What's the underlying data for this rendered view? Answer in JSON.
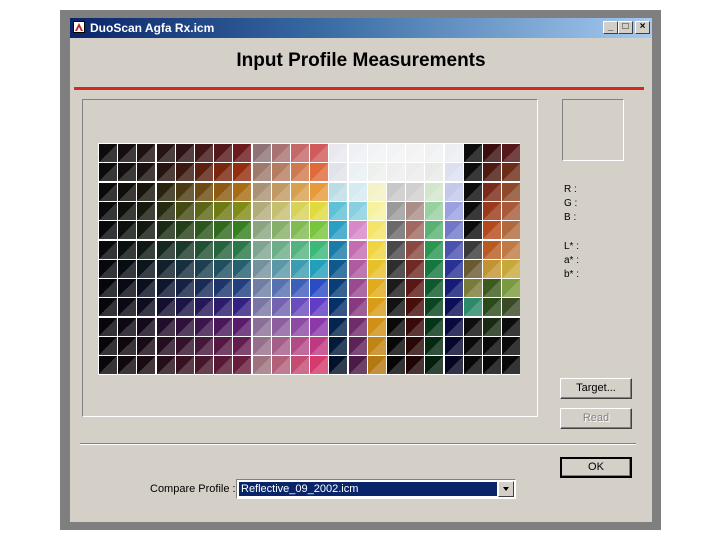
{
  "window": {
    "title": "DuoScan Agfa Rx.icm",
    "buttons": {
      "minimize": "_",
      "maximize": "□",
      "close": "×"
    }
  },
  "heading": "Input Profile Measurements",
  "readouts": {
    "r": "R :",
    "g": "G :",
    "b": "B :",
    "l": "L* :",
    "a": "a* :",
    "bstar": "b* :"
  },
  "buttons": {
    "target": "Target...",
    "read": "Read",
    "ok": "OK"
  },
  "compare": {
    "label": "Compare Profile :",
    "selected": "Reflective_09_2002.icm"
  },
  "colors": {
    "title_gradient_start": "#0a246a",
    "accent_rule": "#d42a1a",
    "dialog_bg": "#d4d0c8",
    "selection": "#0a246a"
  },
  "target_grid": {
    "columns": 22,
    "rows": 12,
    "rows_colors": [
      [
        "#0d0b0c",
        "#140e0f",
        "#1d1111",
        "#261313",
        "#2e1316",
        "#401616",
        "#55181a",
        "#6c1a1c",
        "#8e7374",
        "#aa7171",
        "#c46868",
        "#d05a5c",
        "#e8e8ee",
        "#eef0f4",
        "#f2f3f5",
        "#f2f3f4",
        "#f3f3f4",
        "#f0f1f2",
        "#eceef3",
        "#0c0c0c",
        "#3a0e0e",
        "#55181a"
      ],
      [
        "#0b0b0b",
        "#110e0d",
        "#1b1110",
        "#27130f",
        "#3a1a10",
        "#5c2010",
        "#78260e",
        "#952c0e",
        "#9e7a6d",
        "#b67c62",
        "#cf7a4e",
        "#df6b3a",
        "#e2e3ea",
        "#eaf0f4",
        "#eef0ee",
        "#eeeeee",
        "#ececec",
        "#e7eae6",
        "#dcdff0",
        "#0c0c0c",
        "#4c1a10",
        "#6b2c18"
      ],
      [
        "#0a0a0a",
        "#0f0e0b",
        "#18150d",
        "#2a220d",
        "#4a3a12",
        "#6c4a12",
        "#8c5a10",
        "#a86c12",
        "#a99275",
        "#c09a62",
        "#d7a04e",
        "#e79a3a",
        "#bcdde6",
        "#d5ebf2",
        "#f4f2c6",
        "#c8c8c8",
        "#d0d0d0",
        "#d2e6cc",
        "#c4c8ea",
        "#0c0c0c",
        "#7a2a18",
        "#8c4a2a"
      ],
      [
        "#090a09",
        "#0e100c",
        "#17190d",
        "#262a0e",
        "#444a12",
        "#5c6614",
        "#6e7a14",
        "#808c16",
        "#b1ac7a",
        "#c4c070",
        "#d8d25a",
        "#e0da3e",
        "#5fc1d6",
        "#88cfe2",
        "#f7f2a0",
        "#9a9a9a",
        "#ac8e88",
        "#98d0a0",
        "#9aa0e0",
        "#0c0c0c",
        "#9a3a1a",
        "#a85a3a"
      ],
      [
        "#08090a",
        "#0c110d",
        "#121a10",
        "#1a2a14",
        "#24401a",
        "#2c561c",
        "#306a1e",
        "#348020",
        "#8aa580",
        "#86b06a",
        "#80bc52",
        "#78c63c",
        "#2a9fc2",
        "#d688c8",
        "#f4e468",
        "#6a6a6a",
        "#a06a62",
        "#5ab272",
        "#7278c8",
        "#0c0c0c",
        "#b44a1c",
        "#b06a3e"
      ],
      [
        "#07090a",
        "#0a100f",
        "#0f1914",
        "#15281f",
        "#1c3a2a",
        "#225034",
        "#26643e",
        "#2a7848",
        "#7fa590",
        "#6cae88",
        "#54b480",
        "#3cb878",
        "#1a7aa8",
        "#c46cb0",
        "#f0d440",
        "#4a4a4a",
        "#8a4a42",
        "#2a9652",
        "#4a52b0",
        "#3a3a3a",
        "#b85a22",
        "#c07a44"
      ],
      [
        "#06080b",
        "#080d12",
        "#0c141c",
        "#10202c",
        "#16303e",
        "#1c4050",
        "#205060",
        "#246070",
        "#74929e",
        "#5a98a8",
        "#3e9cb2",
        "#22a0ba",
        "#0e5a8e",
        "#b05aa0",
        "#e8c02a",
        "#2e2e2e",
        "#702a24",
        "#16783e",
        "#2a3296",
        "#6a5a32",
        "#c09432",
        "#c8a83a"
      ],
      [
        "#06070b",
        "#080a14",
        "#0b0f20",
        "#0e1630",
        "#142244",
        "#182c58",
        "#1c366c",
        "#204080",
        "#6e7ea4",
        "#5670b0",
        "#3e5ebc",
        "#2a4cc4",
        "#0a3e78",
        "#9a4890",
        "#e0ac1c",
        "#1c1c1c",
        "#5a1814",
        "#0e5a2c",
        "#141c78",
        "#7a7a3a",
        "#3a5a1e",
        "#7a9a40"
      ],
      [
        "#07070b",
        "#0a0914",
        "#0e0c20",
        "#140f30",
        "#1c1444",
        "#241858",
        "#2c1c6c",
        "#342080",
        "#7a76a4",
        "#7262b0",
        "#6a4cbc",
        "#623cc4",
        "#07306a",
        "#883a80",
        "#d89c18",
        "#121212",
        "#480e0c",
        "#0a4420",
        "#0c1058",
        "#2a8a6a",
        "#2a4a1a",
        "#3a4a26"
      ],
      [
        "#08060a",
        "#0e0812",
        "#150a1c",
        "#200e2a",
        "#2e123a",
        "#3c164a",
        "#4a185a",
        "#581c6a",
        "#8a7098",
        "#8c5e9e",
        "#8c4aa4",
        "#8c38aa",
        "#05244e",
        "#702c6a",
        "#d09016",
        "#0a0a0a",
        "#380a0a",
        "#063418",
        "#080a40",
        "#0e0e0e",
        "#1a2a12",
        "#0c0c0c"
      ],
      [
        "#09060a",
        "#10070f",
        "#180a16",
        "#240e20",
        "#34122c",
        "#441638",
        "#541844",
        "#641c50",
        "#96708a",
        "#a45e8a",
        "#b24a86",
        "#c03882",
        "#031a3a",
        "#5e2258",
        "#c08414",
        "#080808",
        "#2a0808",
        "#042810",
        "#06072e",
        "#0a0a0a",
        "#0a0a0a",
        "#0a0a0a"
      ],
      [
        "#0a070a",
        "#11080d",
        "#1a0a12",
        "#260e18",
        "#361220",
        "#46162a",
        "#561832",
        "#661c3a",
        "#9e727e",
        "#b2607a",
        "#c44c72",
        "#d43a6c",
        "#02122a",
        "#4c1a46",
        "#b47812",
        "#060606",
        "#1e0606",
        "#031e0c",
        "#040520",
        "#080808",
        "#080808",
        "#080808"
      ]
    ]
  }
}
